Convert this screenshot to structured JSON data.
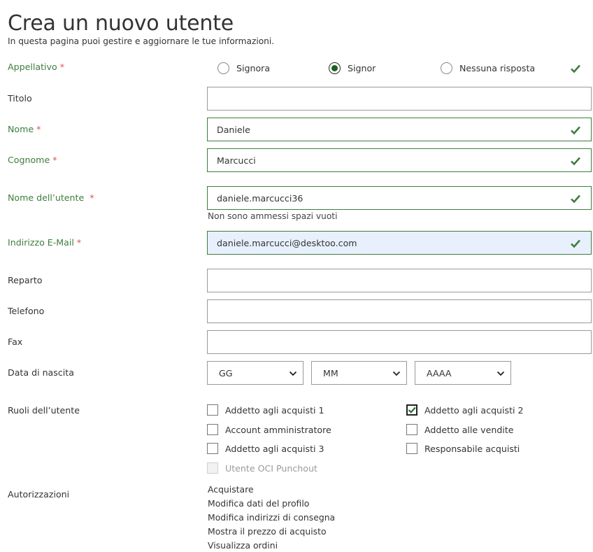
{
  "page": {
    "title": "Crea un nuovo utente",
    "subtitle": "In questa pagina puoi gestire e aggiornare le tue informazioni."
  },
  "colors": {
    "valid": "#3e7d3e",
    "required": "#d9534f",
    "focused_bg": "#e8f0fe"
  },
  "salutation": {
    "label": "Appellativo",
    "required_mark": "*",
    "options": [
      "Signora",
      "Signor",
      "Nessuna risposta"
    ],
    "selected": "Signor"
  },
  "fields": {
    "titolo": {
      "label": "Titolo",
      "value": ""
    },
    "nome": {
      "label": "Nome",
      "required_mark": "*",
      "value": "Daniele"
    },
    "cognome": {
      "label": "Cognome",
      "required_mark": "*",
      "value": "Marcucci"
    },
    "username": {
      "label": "Nome dell’utente",
      "required_mark": "*",
      "value": "daniele.marcucci36",
      "help": "Non sono ammessi spazi vuoti"
    },
    "email": {
      "label": "Indirizzo E-Mail",
      "required_mark": "*",
      "value": "daniele.marcucci@desktoo.com"
    },
    "reparto": {
      "label": "Reparto",
      "value": ""
    },
    "telefono": {
      "label": "Telefono",
      "value": ""
    },
    "fax": {
      "label": "Fax",
      "value": ""
    }
  },
  "birthdate": {
    "label": "Data di nascita",
    "day": "GG",
    "month": "MM",
    "year": "AAAA"
  },
  "roles": {
    "label": "Ruoli dell’utente",
    "items": [
      {
        "label": "Addetto agli acquisti 1",
        "checked": false
      },
      {
        "label": "Addetto agli acquisti 2",
        "checked": true
      },
      {
        "label": "Account amministratore",
        "checked": false
      },
      {
        "label": "Addetto alle vendite",
        "checked": false
      },
      {
        "label": "Addetto agli acquisti 3",
        "checked": false
      },
      {
        "label": "Responsabile acquisti",
        "checked": false
      },
      {
        "label": "Utente OCI Punchout",
        "checked": false,
        "disabled": true
      }
    ]
  },
  "permissions": {
    "label": "Autorizzazioni",
    "items": [
      "Acquistare",
      "Modifica dati del profilo",
      "Modifica indirizzi di consegna",
      "Mostra il prezzo di acquisto",
      "Visualizza ordini"
    ]
  }
}
